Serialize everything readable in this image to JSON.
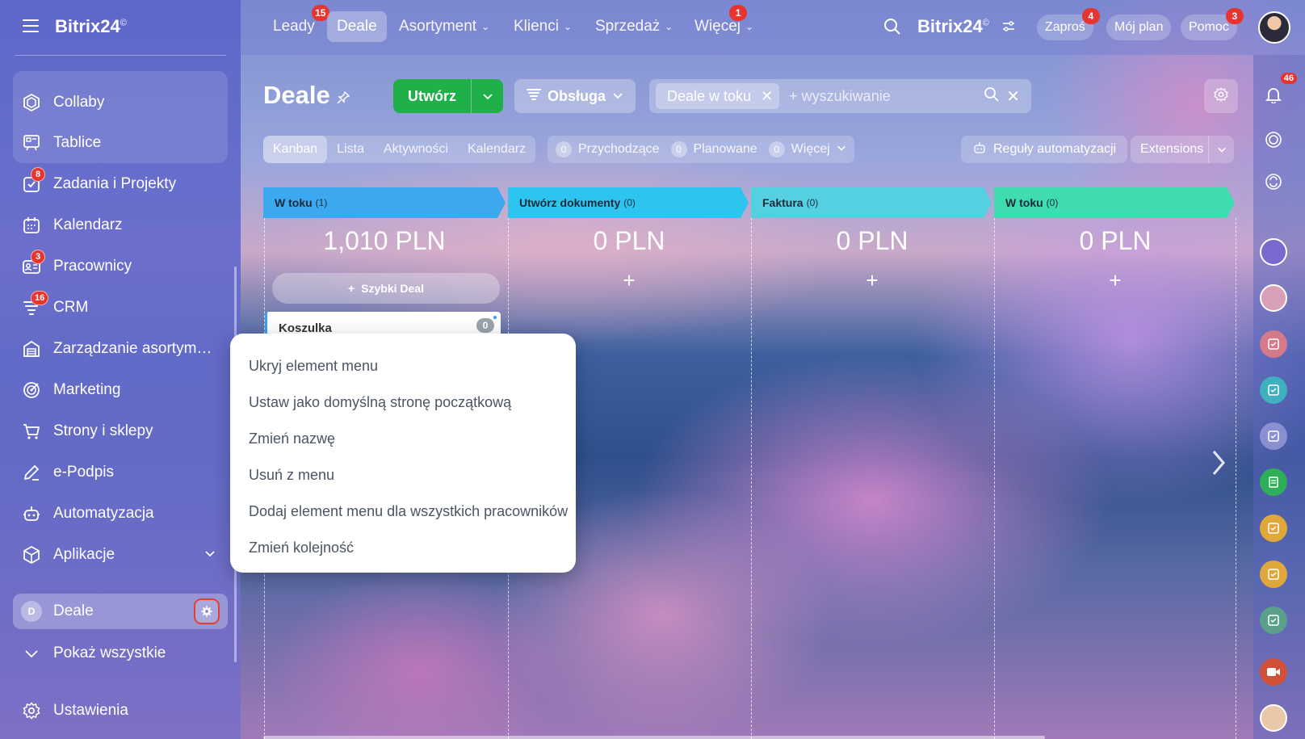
{
  "sidebar": {
    "logo": "Bitrix24",
    "logo_mark": "©",
    "items": [
      {
        "label": "Collaby",
        "icon": "collab-icon",
        "badge": ""
      },
      {
        "label": "Tablice",
        "icon": "board-icon",
        "badge": ""
      },
      {
        "label": "Zadania i Projekty",
        "icon": "tasks-icon",
        "badge": "8"
      },
      {
        "label": "Kalendarz",
        "icon": "calendar-icon",
        "badge": ""
      },
      {
        "label": "Pracownicy",
        "icon": "employees-icon",
        "badge": "3"
      },
      {
        "label": "CRM",
        "icon": "crm-icon",
        "badge": "16"
      },
      {
        "label": "Zarządzanie asortymen...",
        "icon": "inventory-icon",
        "badge": ""
      },
      {
        "label": "Marketing",
        "icon": "marketing-icon",
        "badge": ""
      },
      {
        "label": "Strony i sklepy",
        "icon": "cart-icon",
        "badge": ""
      },
      {
        "label": "e-Podpis",
        "icon": "signature-icon",
        "badge": ""
      },
      {
        "label": "Automatyzacja",
        "icon": "robot-icon",
        "badge": ""
      },
      {
        "label": "Aplikacje",
        "icon": "apps-icon",
        "badge": ""
      }
    ],
    "active_item": {
      "letter": "D",
      "label": "Deale"
    },
    "show_all": "Pokaż wszystkie",
    "settings": "Ustawienia"
  },
  "topbar": {
    "nav": [
      {
        "label": "Leady",
        "badge": "15",
        "dropdown": false
      },
      {
        "label": "Deale",
        "badge": "",
        "dropdown": false
      },
      {
        "label": "Asortyment",
        "badge": "",
        "dropdown": true
      },
      {
        "label": "Klienci",
        "badge": "",
        "dropdown": true
      },
      {
        "label": "Sprzedaż",
        "badge": "",
        "dropdown": true
      },
      {
        "label": "Więcej",
        "badge": "1",
        "dropdown": true
      }
    ],
    "brand": "Bitrix24",
    "brand_mark": "©",
    "invite": "Zaproś",
    "invite_badge": "4",
    "my_plan": "Mój plan",
    "help": "Pomoc",
    "help_badge": "3"
  },
  "page": {
    "title": "Deale",
    "create_button": "Utwórz",
    "pipeline_button": "Obsługa",
    "filter_chip": "Deale w toku",
    "search_placeholder": "+ wyszukiwanie",
    "views": [
      "Kanban",
      "Lista",
      "Aktywności",
      "Kalendarz"
    ],
    "counters": [
      {
        "count": "0",
        "label": "Przychodzące"
      },
      {
        "count": "0",
        "label": "Planowane"
      },
      {
        "count": "0",
        "label": "Więcej"
      }
    ],
    "automation_rules": "Reguły automatyzacji",
    "extensions": "Extensions"
  },
  "kanban": {
    "columns": [
      {
        "title": "W toku",
        "count": "(1)",
        "sum": "1,010 PLN",
        "color": "#3ba8f0"
      },
      {
        "title": "Utwórz dokumenty",
        "count": "(0)",
        "sum": "0 PLN",
        "color": "#2ec4f0"
      },
      {
        "title": "Faktura",
        "count": "(0)",
        "sum": "0 PLN",
        "color": "#55d0e0"
      },
      {
        "title": "W toku",
        "count": "(0)",
        "sum": "0 PLN",
        "color": "#3fdcb0"
      }
    ],
    "quick_deal": "Szybki Deal",
    "add_symbol": "+",
    "card": {
      "title": "Koszulka",
      "count": "0"
    }
  },
  "context_menu": {
    "items": [
      "Ukryj element menu",
      "Ustaw jako domyślną stronę początkową",
      "Zmień nazwę",
      "Usuń z menu",
      "Dodaj element menu dla wszystkich pracowników",
      "Zmień kolejność"
    ]
  },
  "rail": {
    "notifications_badge": "46"
  },
  "colors": {
    "accent_green": "#1fb04a",
    "badge_red": "#e8342f",
    "highlight_ring": "#e2402c"
  }
}
